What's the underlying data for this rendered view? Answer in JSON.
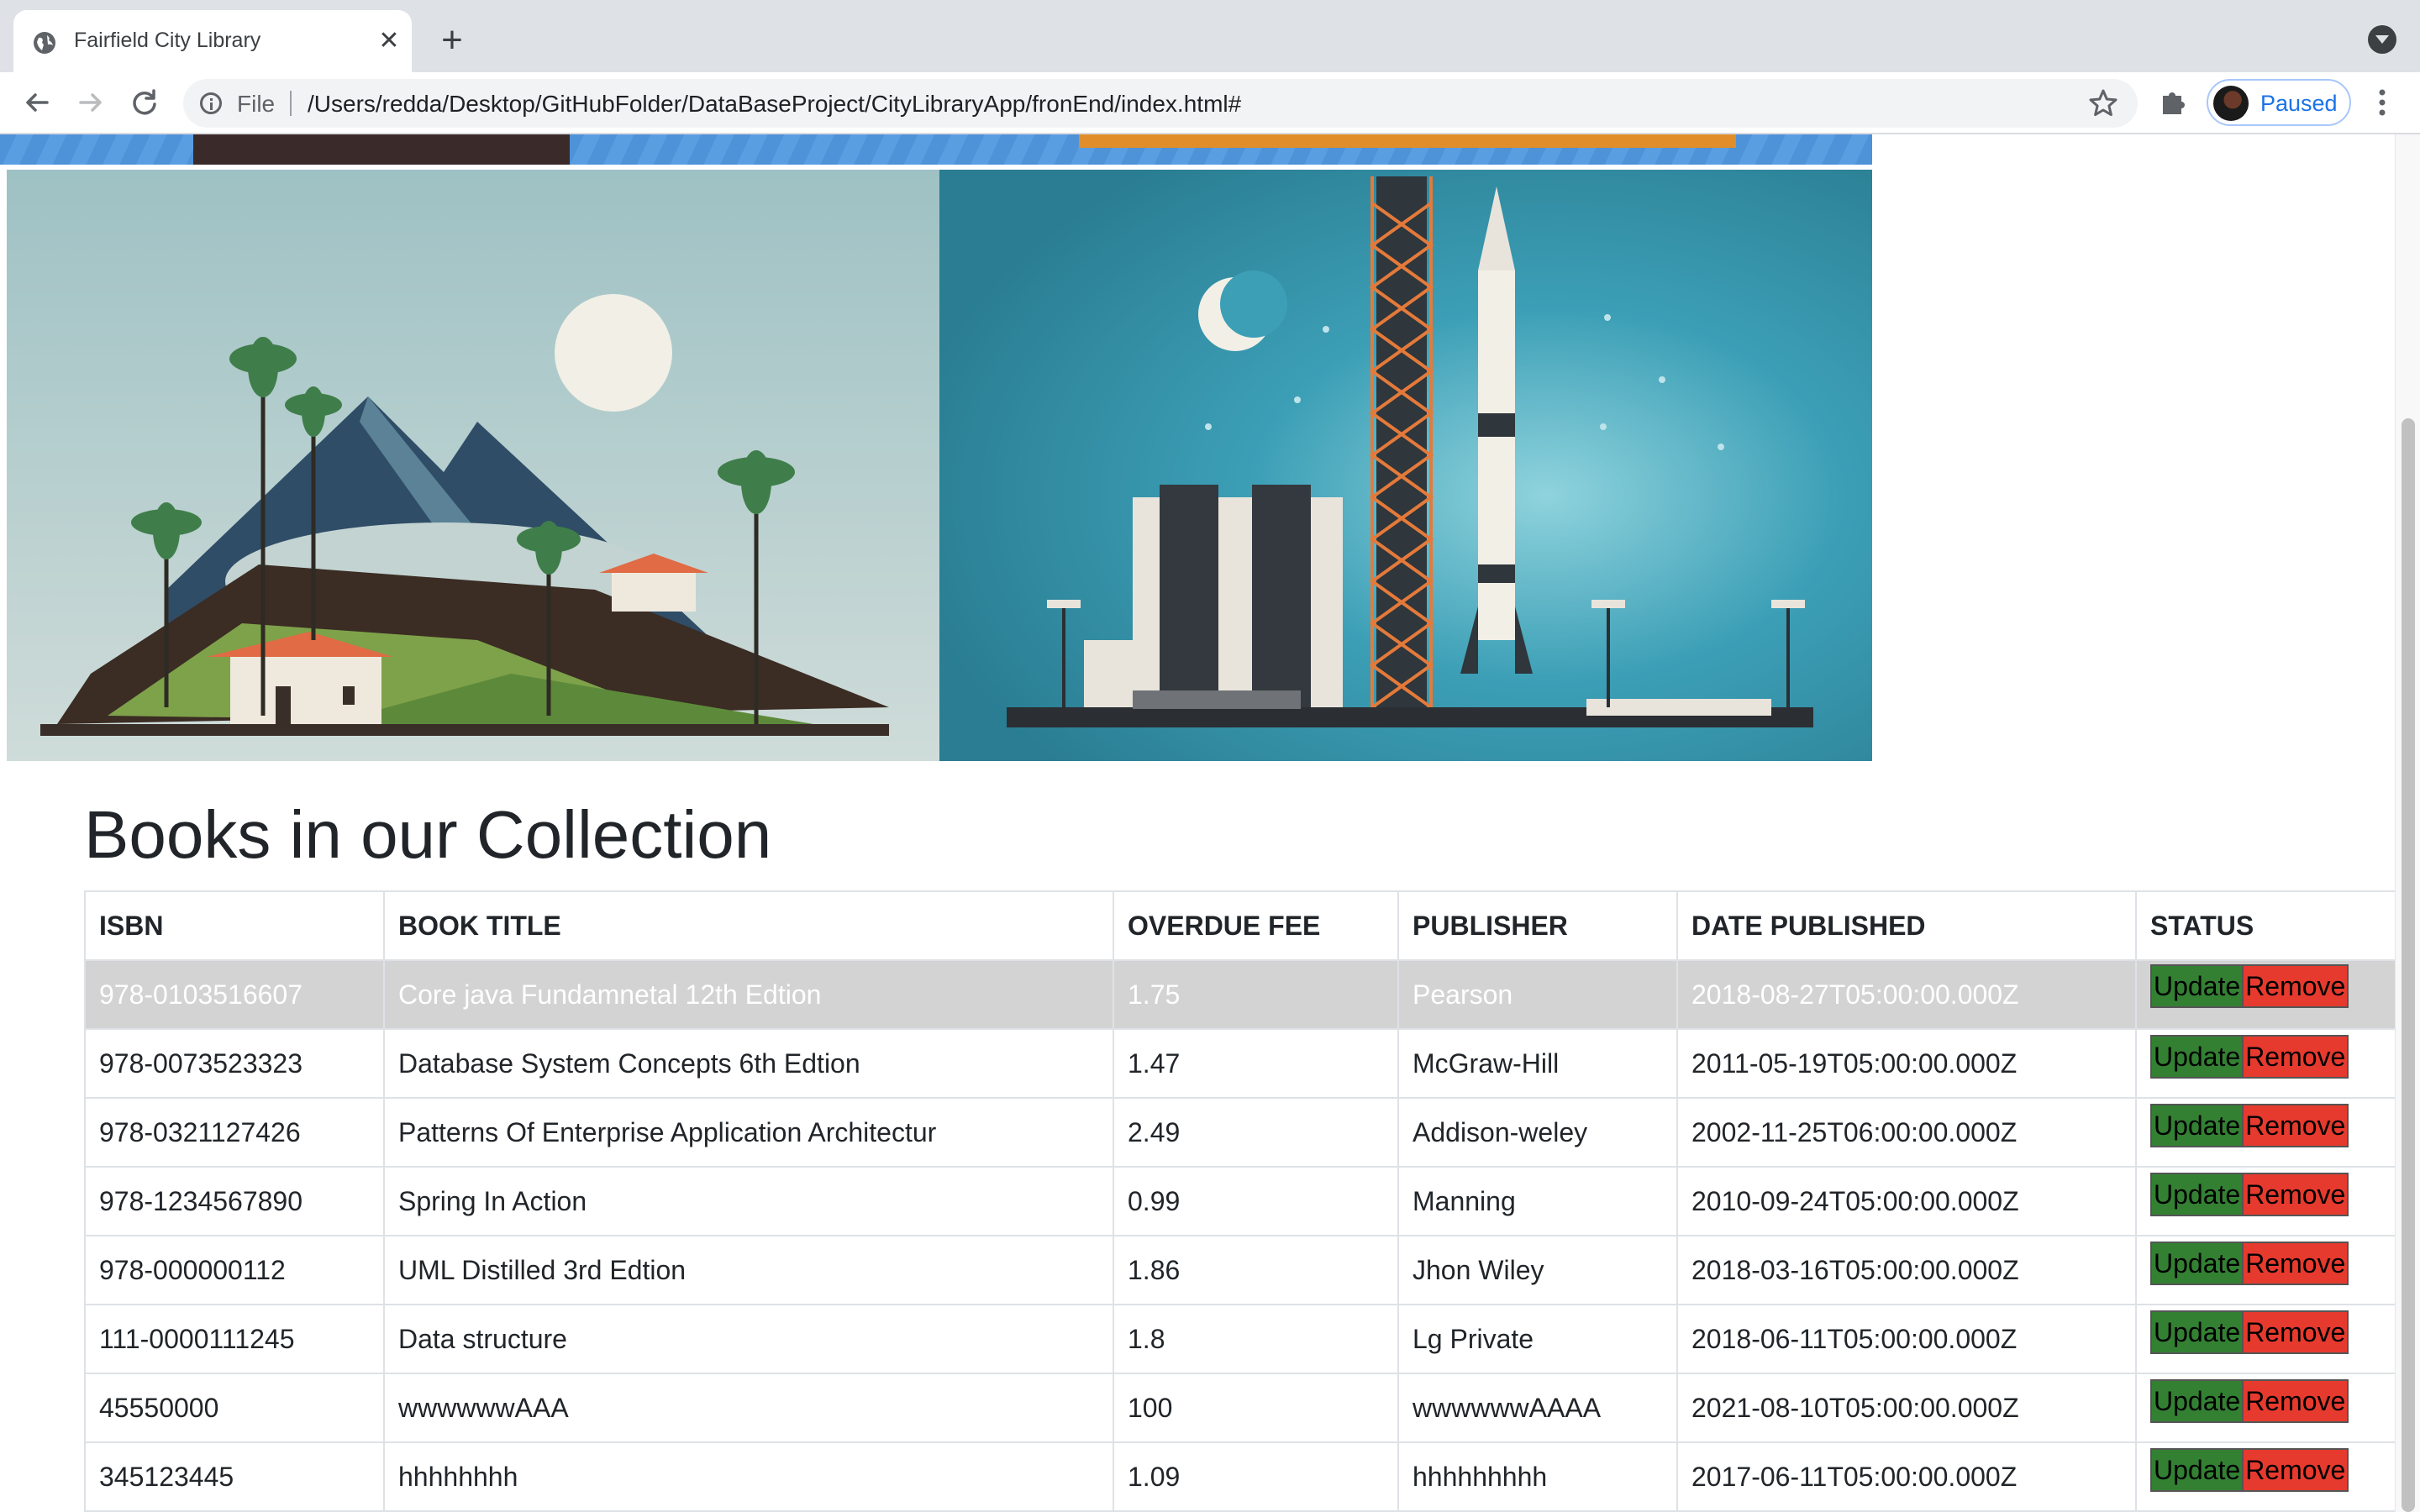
{
  "browser": {
    "tab_title": "Fairfield City Library",
    "tab_close": "✕",
    "new_tab": "+",
    "file_label": "File",
    "url": "/Users/redda/Desktop/GitHubFolder/DataBaseProject/CityLibraryApp/fronEnd/index.html#",
    "profile_status": "Paused",
    "icons": {
      "back": "back-arrow-icon",
      "forward": "forward-arrow-icon",
      "reload": "reload-icon",
      "info": "info-icon",
      "star": "star-icon",
      "extensions": "puzzle-icon",
      "menu": "kebab-menu-icon"
    }
  },
  "page": {
    "heading": "Books in our Collection",
    "banner_images": [
      "tropical-hills-landscape-illustration",
      "rocket-launch-pad-illustration"
    ],
    "table": {
      "headers": [
        "ISBN",
        "BOOK TITLE",
        "OVERDUE FEE",
        "PUBLISHER",
        "DATE PUBLISHED",
        "STATUS"
      ],
      "update_label": "Update",
      "remove_label": "Remove",
      "rows": [
        {
          "isbn": "978-0103516607",
          "title": "Core java Fundamnetal 12th Edtion",
          "fee": "1.75",
          "publisher": "Pearson",
          "date": "2018-08-27T05:00:00.000Z"
        },
        {
          "isbn": "978-0073523323",
          "title": "Database System Concepts 6th Edtion",
          "fee": "1.47",
          "publisher": "McGraw-Hill",
          "date": "2011-05-19T05:00:00.000Z"
        },
        {
          "isbn": "978-0321127426",
          "title": "Patterns Of Enterprise Application Architectur",
          "fee": "2.49",
          "publisher": "Addison-weley",
          "date": "2002-11-25T06:00:00.000Z"
        },
        {
          "isbn": "978-1234567890",
          "title": "Spring In Action",
          "fee": "0.99",
          "publisher": "Manning",
          "date": "2010-09-24T05:00:00.000Z"
        },
        {
          "isbn": "978-000000112",
          "title": "UML Distilled 3rd Edtion",
          "fee": "1.86",
          "publisher": "Jhon Wiley",
          "date": "2018-03-16T05:00:00.000Z"
        },
        {
          "isbn": "111-0000111245",
          "title": "Data structure",
          "fee": "1.8",
          "publisher": "Lg Private",
          "date": "2018-06-11T05:00:00.000Z"
        },
        {
          "isbn": "45550000",
          "title": "wwwwwwAAA",
          "fee": "100",
          "publisher": "wwwwwwAAAA",
          "date": "2021-08-10T05:00:00.000Z"
        },
        {
          "isbn": "345123445",
          "title": "hhhhhhhh",
          "fee": "1.09",
          "publisher": "hhhhhhhhh",
          "date": "2017-06-11T05:00:00.000Z"
        }
      ]
    },
    "colors": {
      "update_button": "#338033",
      "remove_button": "#e63a2e",
      "selected_row": "#d3d3d3"
    }
  }
}
